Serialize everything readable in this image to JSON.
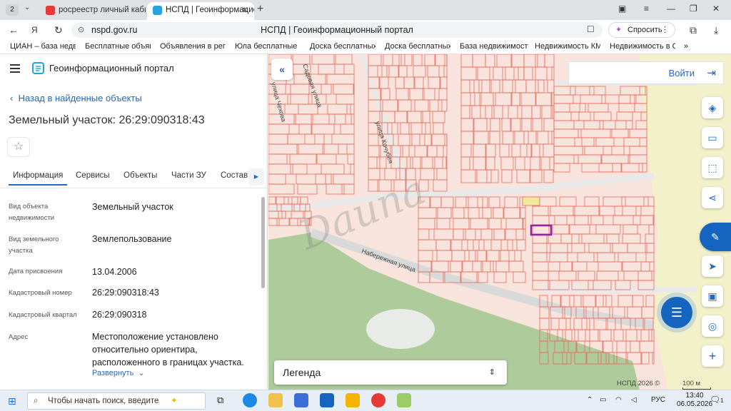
{
  "browser": {
    "tab_count": "2",
    "tabs": [
      {
        "title": "росреестр личный кабин"
      },
      {
        "title": "НСПД | Геоинформацио"
      }
    ],
    "url": "nspd.gov.ru",
    "page_title": "НСПД | Геоинформационный портал",
    "ask_label": "Спросить",
    "bookmarks": [
      "ЦИАН – база недви",
      "Бесплатные объявл",
      "Объявления в регис",
      "Юла бесплатные об",
      "Доска бесплатных о",
      "Доска бесплатных о",
      "База недвижимости",
      "Недвижимость КМВ",
      "Недвижимость в Ст"
    ]
  },
  "panel": {
    "portal_title": "Геоинформационный портал",
    "back_link": "Назад в найденные объекты",
    "object_title": "Земельный участок: 26:29:090318:43",
    "tabs": [
      "Информация",
      "Сервисы",
      "Объекты",
      "Части ЗУ",
      "Состав"
    ],
    "fields": [
      {
        "label": "Вид объекта недвижимости",
        "value": "Земельный участок"
      },
      {
        "label": "Вид земельного участка",
        "value": "Землепользование"
      },
      {
        "label": "Дата присвоения",
        "value": "13.04.2006"
      },
      {
        "label": "Кадастровый номер",
        "value": "26:29:090318:43"
      },
      {
        "label": "Кадастровый квартал",
        "value": "26:29:090318"
      },
      {
        "label": "Адрес",
        "value": "Местоположение установлено относительно ориентира, расположенного в границах участка."
      }
    ],
    "expand_label": "Развернуть"
  },
  "map": {
    "login_label": "Войти",
    "legend_label": "Легенда",
    "copyright": "НСПД 2026 ©",
    "scale": "100 м",
    "street_labels": [
      "Набережная улица",
      "улица Кочубея",
      "Садовая улица",
      "улица Чехова"
    ],
    "watermark": "Dauna"
  },
  "taskbar": {
    "search_placeholder": "Чтобы начать поиск, введите",
    "lang": "РУС",
    "time": "13:40",
    "date": "06.05.2026",
    "notifications": "1"
  }
}
